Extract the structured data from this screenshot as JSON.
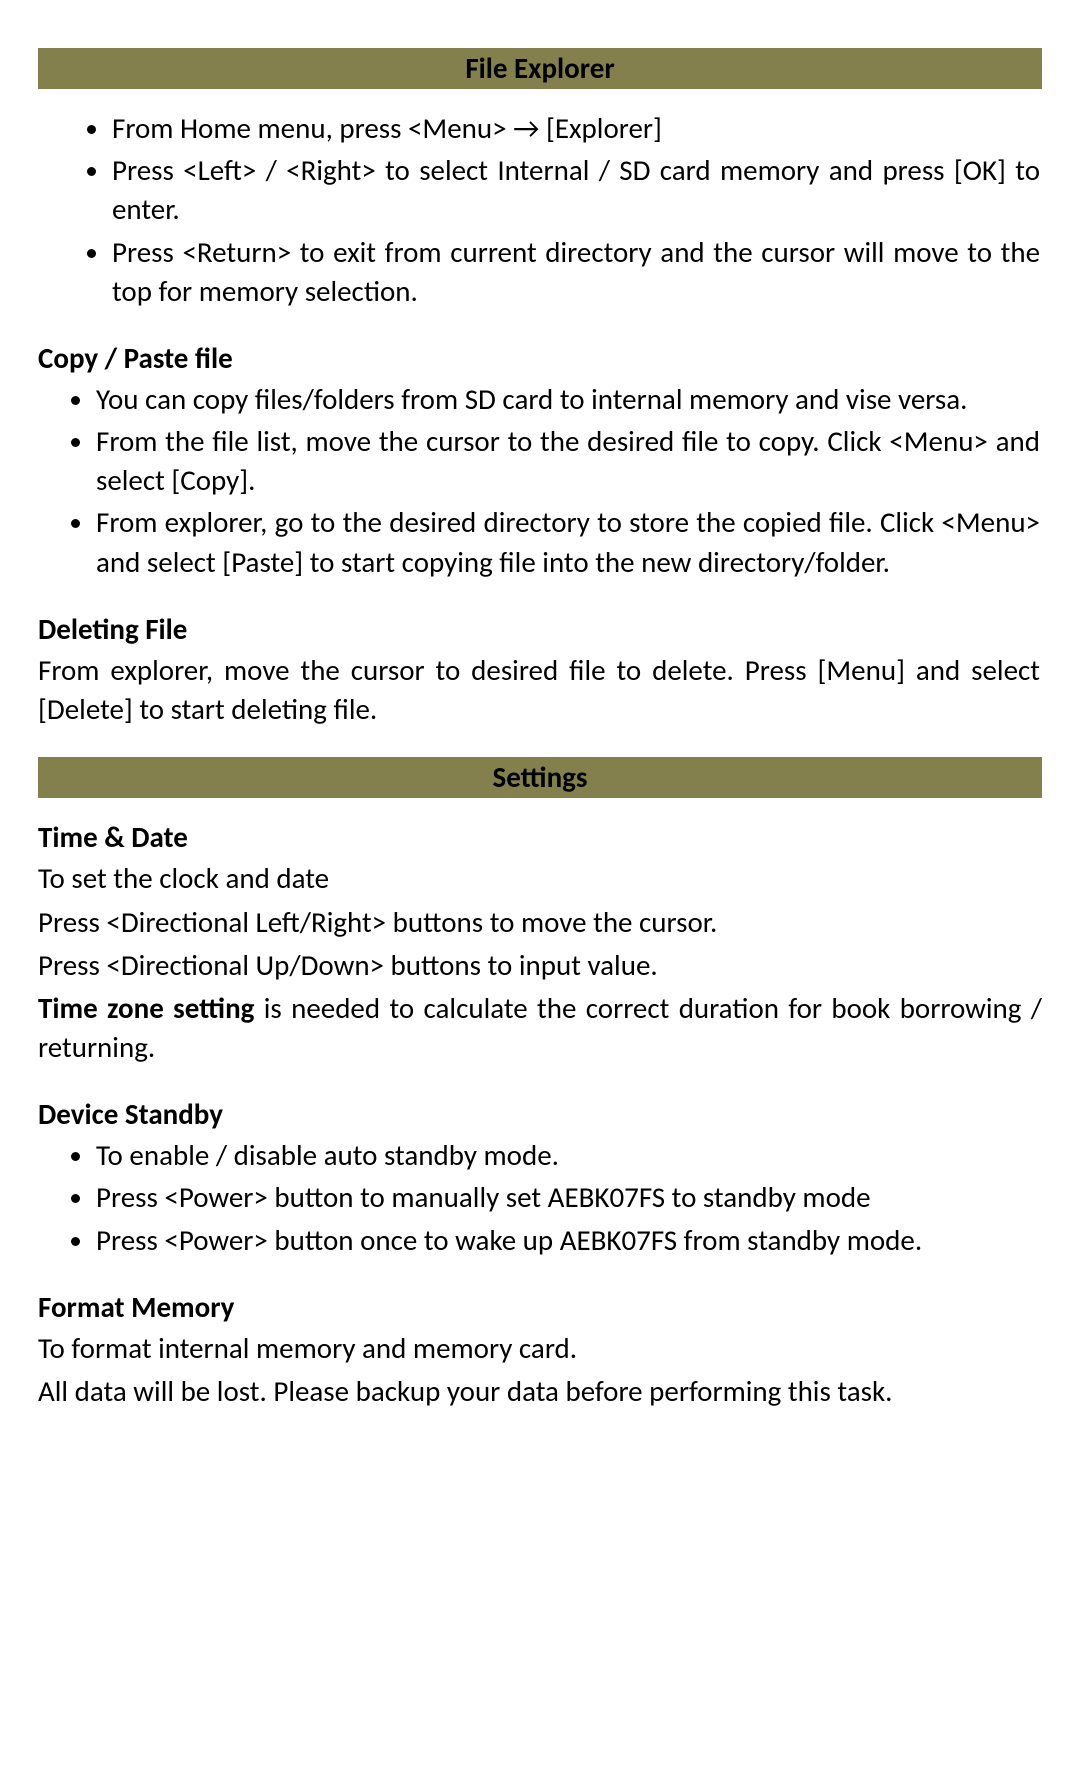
{
  "header1": "File Explorer",
  "fe_bullets": [
    "From Home menu, press <Menu> →  [Explorer]",
    "Press <Left> / <Right> to select Internal / SD card memory and press [OK] to enter.",
    "Press <Return> to exit from current directory and the cursor will move to the top for memory selection."
  ],
  "copy_heading": "Copy / Paste file",
  "copy_bullets": [
    "You can copy files/folders from SD card to internal memory and vise versa.",
    "From the file list, move the cursor to the desired file to copy. Click <Menu> and select [Copy].",
    "From explorer, go to the desired directory to store the copied file. Click <Menu> and select [Paste] to start copying file into the new directory/folder."
  ],
  "delete_heading": "Deleting File",
  "delete_para": "From explorer, move the cursor to desired file to delete. Press [Menu] and select [Delete] to start deleting file.",
  "header2": "Settings",
  "time_heading": "Time & Date",
  "time_p1": "To set the clock and date",
  "time_p2": "Press <Directional Left/Right> buttons to move the cursor.",
  "time_p3": "Press <Directional Up/Down> buttons to input value.",
  "tz_bold": "Time zone setting",
  "tz_rest": " is needed to calculate the correct duration for book borrowing / returning.",
  "standby_heading": "Device Standby",
  "standby_bullets": [
    "To enable / disable auto standby mode.",
    "Press <Power> button to manually set AEBK07FS to standby mode",
    "Press <Power> button once to wake up AEBK07FS from standby mode."
  ],
  "format_heading": "Format Memory",
  "format_p1": "To format internal memory and memory card.",
  "format_p2": "All data will be lost. Please backup your data before performing this task."
}
